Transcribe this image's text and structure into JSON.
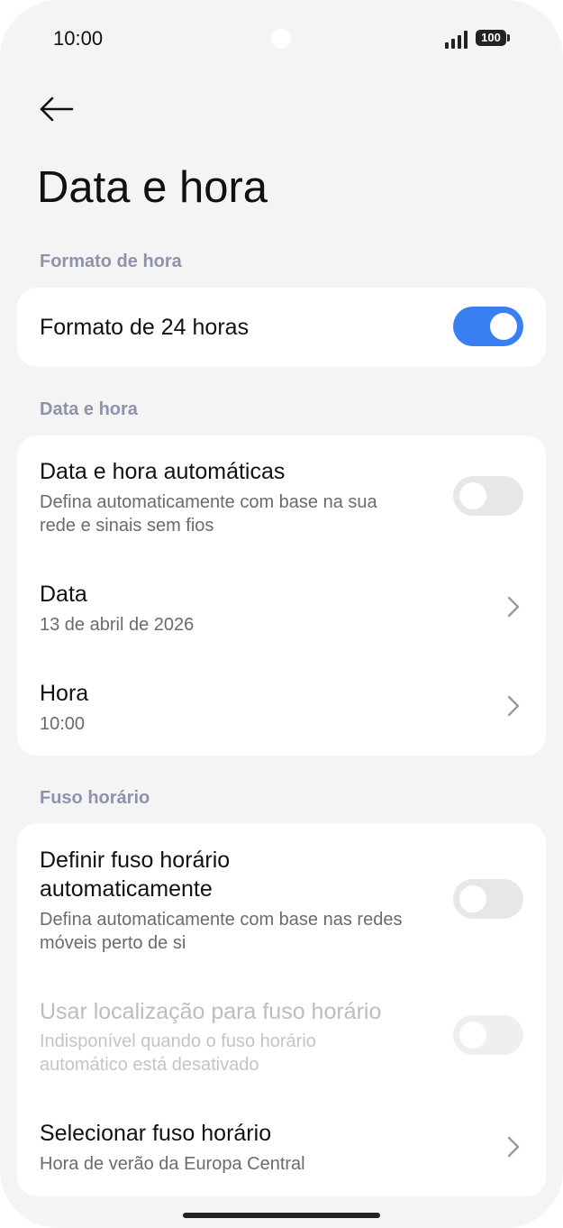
{
  "status_bar": {
    "time": "10:00",
    "battery": "100"
  },
  "header": {
    "title": "Data e hora"
  },
  "sections": {
    "time_format": {
      "header": "Formato de hora",
      "format_24h": {
        "title": "Formato de 24 horas",
        "enabled": true
      }
    },
    "date_time": {
      "header": "Data e hora",
      "auto": {
        "title": "Data e hora automáticas",
        "subtitle_line1": "Defina automaticamente com base na sua",
        "subtitle_line2": "rede e sinais sem fios",
        "enabled": false
      },
      "date": {
        "title": "Data",
        "value": "13 de abril de 2026"
      },
      "time": {
        "title": "Hora",
        "value": "10:00"
      }
    },
    "timezone": {
      "header": "Fuso horário",
      "auto": {
        "title_line1": "Definir fuso horário",
        "title_line2": "automaticamente",
        "subtitle_line1": "Defina automaticamente com base nas redes",
        "subtitle_line2": "móveis perto de si",
        "enabled": false
      },
      "use_location": {
        "title": "Usar localização para fuso horário",
        "subtitle_line1": "Indisponível quando o fuso horário",
        "subtitle_line2": "automático está desativado",
        "enabled": false,
        "disabled": true
      },
      "select": {
        "title": "Selecionar fuso horário",
        "value": "Hora de verão da Europa Central"
      }
    }
  },
  "colors": {
    "accent": "#3a7ff2",
    "section_header": "#8d93ad",
    "background": "#f4f4f4"
  },
  "icons": {
    "back": "arrow-left-icon",
    "chevron": "chevron-right-icon",
    "signal": "signal-icon",
    "battery": "battery-icon"
  }
}
